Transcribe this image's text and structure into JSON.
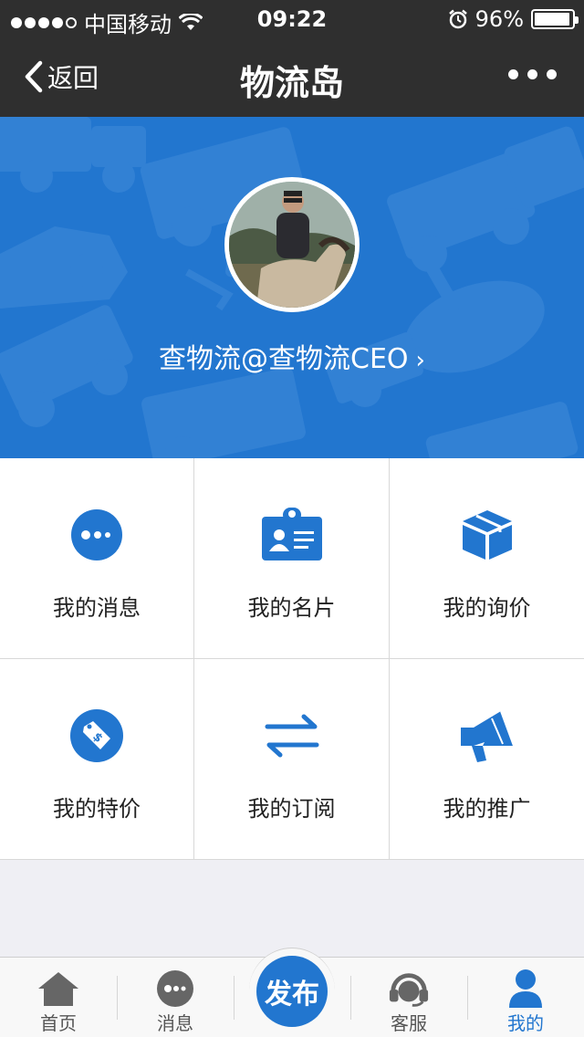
{
  "status_bar": {
    "carrier": "中国移动",
    "time": "09:22",
    "battery": "96%",
    "battery_level": 0.96
  },
  "nav": {
    "back_label": "返回",
    "title": "物流岛"
  },
  "profile": {
    "username": "查物流@查物流CEO",
    "chevron": "›"
  },
  "menu": [
    {
      "label": "我的消息",
      "icon": "chat-bubble-icon"
    },
    {
      "label": "我的名片",
      "icon": "id-card-icon"
    },
    {
      "label": "我的询价",
      "icon": "package-box-icon"
    },
    {
      "label": "我的特价",
      "icon": "price-tag-icon"
    },
    {
      "label": "我的订阅",
      "icon": "swap-arrows-icon"
    },
    {
      "label": "我的推广",
      "icon": "megaphone-icon"
    }
  ],
  "tabbar": {
    "home": "首页",
    "messages": "消息",
    "publish": "发布",
    "service": "客服",
    "mine": "我的"
  },
  "colors": {
    "accent": "#2276cf",
    "nav_bg": "#2f2f2f",
    "page_bg": "#efeff4"
  }
}
